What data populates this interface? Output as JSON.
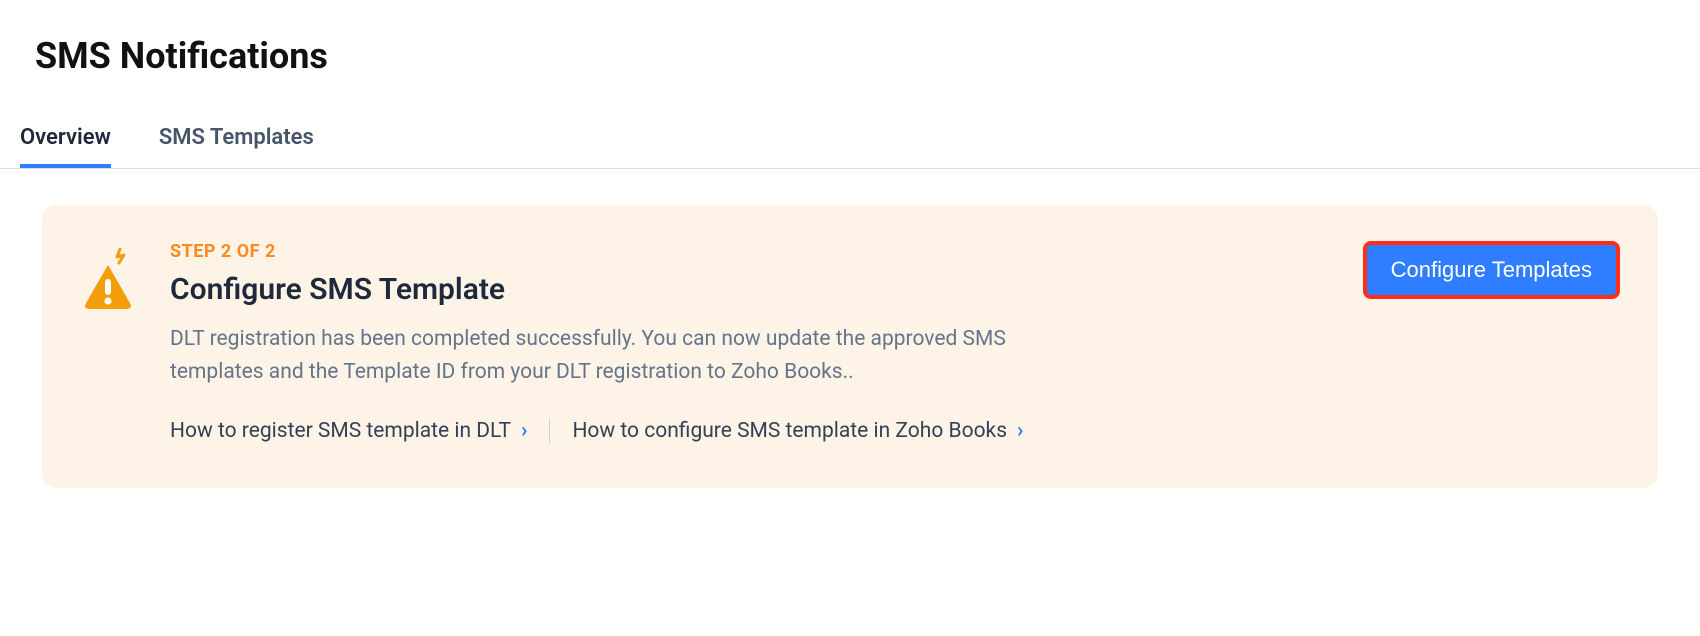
{
  "page": {
    "title": "SMS Notifications"
  },
  "tabs": {
    "overview": "Overview",
    "templates": "SMS Templates"
  },
  "notice": {
    "step": "STEP 2 OF 2",
    "heading": "Configure SMS Template",
    "description": "DLT registration has been completed successfully. You can now update the approved SMS templates and the Template ID from your DLT registration to Zoho Books..",
    "link1": "How to register SMS template in DLT",
    "link2": "How to configure SMS template in Zoho Books",
    "cta": "Configure Templates"
  }
}
